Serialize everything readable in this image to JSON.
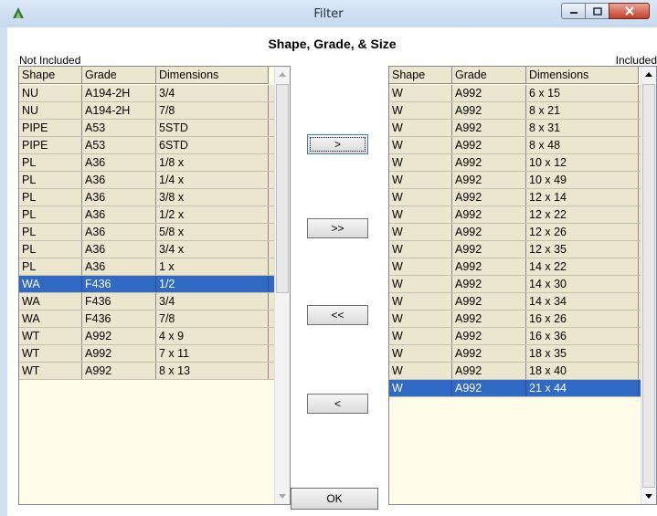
{
  "window": {
    "title": "Filter",
    "icon": "app-icon",
    "controls": [
      "minimize-icon",
      "maximize-icon",
      "close-icon"
    ]
  },
  "heading": "Shape, Grade, & Size",
  "not_included": {
    "label": "Not Included",
    "columns": [
      "Shape",
      "Grade",
      "Dimensions"
    ],
    "rows": [
      [
        "NU",
        "A194-2H",
        "3/4"
      ],
      [
        "NU",
        "A194-2H",
        "7/8"
      ],
      [
        "PIPE",
        "A53",
        "5STD"
      ],
      [
        "PIPE",
        "A53",
        "6STD"
      ],
      [
        "PL",
        "A36",
        "1/8 x"
      ],
      [
        "PL",
        "A36",
        "1/4 x"
      ],
      [
        "PL",
        "A36",
        "3/8 x"
      ],
      [
        "PL",
        "A36",
        "1/2 x"
      ],
      [
        "PL",
        "A36",
        "5/8 x"
      ],
      [
        "PL",
        "A36",
        "3/4 x"
      ],
      [
        "PL",
        "A36",
        "1 x"
      ],
      [
        "WA",
        "F436",
        "1/2"
      ],
      [
        "WA",
        "F436",
        "3/4"
      ],
      [
        "WA",
        "F436",
        "7/8"
      ],
      [
        "WT",
        "A992",
        "4 x 9"
      ],
      [
        "WT",
        "A992",
        "7 x 11"
      ],
      [
        "WT",
        "A992",
        "8 x 13"
      ]
    ],
    "selected_index": 11
  },
  "included": {
    "label": "Included",
    "columns": [
      "Shape",
      "Grade",
      "Dimensions"
    ],
    "rows": [
      [
        "W",
        "A992",
        "6 x 15"
      ],
      [
        "W",
        "A992",
        "8 x 21"
      ],
      [
        "W",
        "A992",
        "8 x 31"
      ],
      [
        "W",
        "A992",
        "8 x 48"
      ],
      [
        "W",
        "A992",
        "10 x 12"
      ],
      [
        "W",
        "A992",
        "10 x 49"
      ],
      [
        "W",
        "A992",
        "12 x 14"
      ],
      [
        "W",
        "A992",
        "12 x 22"
      ],
      [
        "W",
        "A992",
        "12 x 26"
      ],
      [
        "W",
        "A992",
        "12 x 35"
      ],
      [
        "W",
        "A992",
        "14 x 22"
      ],
      [
        "W",
        "A992",
        "14 x 30"
      ],
      [
        "W",
        "A992",
        "14 x 34"
      ],
      [
        "W",
        "A992",
        "16 x 26"
      ],
      [
        "W",
        "A992",
        "16 x 36"
      ],
      [
        "W",
        "A992",
        "18 x 35"
      ],
      [
        "W",
        "A992",
        "18 x 40"
      ],
      [
        "W",
        "A992",
        "21 x 44"
      ]
    ],
    "selected_index": 17
  },
  "buttons": {
    "add_one": ">",
    "add_all": ">>",
    "remove_all": "<<",
    "remove_one": "<",
    "ok": "OK"
  },
  "colors": {
    "selection": "#316ac5",
    "row_background": "#ede6cf",
    "list_background": "#fffce8",
    "titlebar": "#c6d9ef"
  }
}
